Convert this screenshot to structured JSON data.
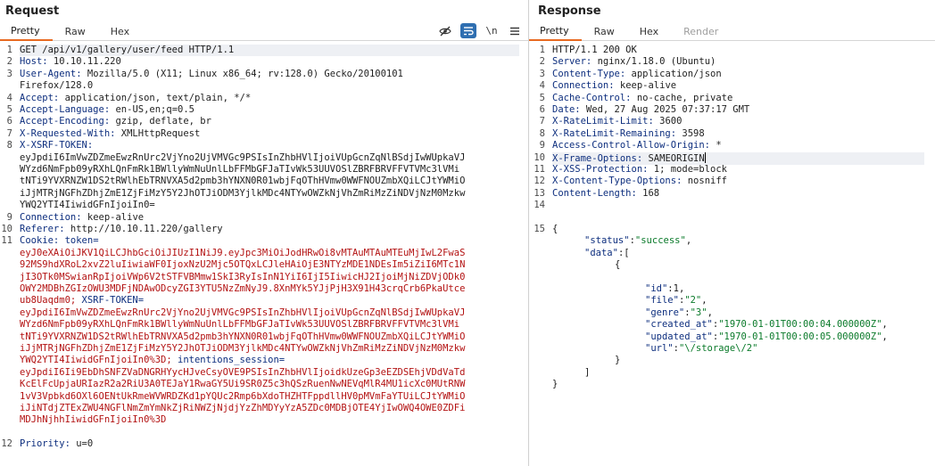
{
  "request": {
    "title": "Request",
    "tabs": [
      "Pretty",
      "Raw",
      "Hex"
    ],
    "toolbar": {
      "hide_icon": "eye-off",
      "wrap_icon": "wrap",
      "newline_label": "\\n",
      "menu_icon": "menu"
    },
    "line_numbers": [
      "1",
      "2",
      "3",
      "",
      "4",
      "5",
      "6",
      "7",
      "8",
      "",
      "",
      "",
      "",
      "",
      "",
      "9",
      "10",
      "11",
      "",
      "",
      "",
      "",
      "",
      "",
      "",
      "",
      "",
      "",
      "",
      "",
      "",
      "",
      "",
      "",
      "",
      "",
      "12"
    ],
    "request_line": "GET /api/v1/gallery/user/feed HTTP/1.1",
    "host_key": "Host:",
    "host_val": " 10.10.11.220",
    "ua_key": "User-Agent:",
    "ua_val": " Mozilla/5.0 (X11; Linux x86_64; rv:128.0) Gecko/20100101",
    "ua_cont": "Firefox/128.0",
    "accept_key": "Accept:",
    "accept_val": " application/json, text/plain, */*",
    "lang_key": "Accept-Language:",
    "lang_val": " en-US,en;q=0.5",
    "enc_key": "Accept-Encoding:",
    "enc_val": " gzip, deflate, br",
    "xrw_key": "X-Requested-With:",
    "xrw_val": " XMLHttpRequest",
    "xsrf_key": "X-XSRF-TOKEN:",
    "xsrf_lines": [
      "eyJpdiI6ImVwZDZmeEwzRnUrc2VjYno2UjVMVGc9PSIsInZhbHVlIjoiVUpGcnZqNlBSdjIwWUpkaVJ",
      "WYzd6NmFpb09yRXhLQnFmRk1BWllyWmNuUnlLbFFMbGFJaTIvWk53UUVOSlZBRFBRVFFVTVMc3lVMi",
      "tNTi9YVXRNZW1DS2tRWlhEbTRNVXA5d2pmb3hYNXN0R01wbjFqOThHVmw0WWFNOUZmbXQiLCJtYWMiO",
      "iJjMTRjNGFhZDhjZmE1ZjFiMzY5Y2JhOTJiODM3YjlkMDc4NTYwOWZkNjVhZmRiMzZiNDVjNzM0Mzkw",
      "YWQ2YTI4IiwidGFnIjoiIn0="
    ],
    "conn_key": "Connection:",
    "conn_val": " keep-alive",
    "ref_key": "Referer:",
    "ref_val": " http://10.10.11.220/gallery",
    "cookie_key": "Cookie:",
    "cookie_name": " token=",
    "cookie_lines": [
      "eyJ0eXAiOiJKV1QiLCJhbGciOiJIUzI1NiJ9.eyJpc3MiOiJodHRwOi8vMTAuMTAuMTEuMjIwL2FwaS",
      "92MS9hdXRoL2xvZ2luIiwiaWF0IjoxNzU2Mjc5OTQxLCJleHAiOjE3NTYzMDE1NDEsIm5iZiI6MTc1N",
      "jI3OTk0MSwianRpIjoiVWp6V2tSTFVBMmw1SkI3RyIsInN1YiI6IjI5IiwicHJ2IjoiMjNiZDVjODk0",
      "OWY2MDBhZGIzOWU3MDFjNDAwODcyZGI3YTU5NzZmNyJ9.8XnMYk5YJjPjH3X91H43crqCrb6PkaUtce",
      "ub8Uaqdm0;"
    ],
    "xsrf2_key": " XSRF-TOKEN=",
    "xsrf2_lines": [
      "eyJpdiI6ImVwZDZmeEwzRnUrc2VjYno2UjVMVGc9PSIsInZhbHVlIjoiVUpGcnZqNlBSdjIwWUpkaVJ",
      "WYzd6NmFpb09yRXhLQnFmRk1BWllyWmNuUnlLbFFMbGFJaTIvWk53UUVOSlZBRFBRVFFVTVMc3lVMi",
      "tNTi9YVXRNZW1DS2tRWlhEbTRNVXA5d2pmb3hYNXN0R01wbjFqOThHVmw0WWFNOUZmbXQiLCJtYWMiO",
      "iJjMTRjNGFhZDhjZmE1ZjFiMzY5Y2JhOTJiODM3YjlkMDc4NTYwOWZkNjVhZmRiMzZiNDVjNzM0Mzkw",
      "YWQ2YTI4IiwidGFnIjoiIn0%3D;"
    ],
    "session_key": " intentions_session=",
    "session_lines": [
      "eyJpdiI6Ii9EbDhSNFZVaDNGRHYycHJveCsyOVE9PSIsInZhbHVlIjoidkUzeGp3eEZDSEhjVDdVaTd",
      "KcElFcUpjaURIazR2a2RiU3A0TEJaY1RwaGY5Ui9SR0Z5c3hQSzRuenNwNEVqMlR4MU1icXc0MUtRNW",
      "1vV3Vpbkd6OXl6OENtUkRmeWVWRDZKd1pYQUc2Rmp6bXdoTHZHTFppdllHV0pMVmFaYTUiLCJtYWMiO",
      "iJiNTdjZTExZWU4NGFlNmZmYmNkZjRiNWZjNjdjYzZhMDYyYzA5ZDc0MDBjOTE4YjIwOWQ4OWE0ZDFi",
      "MDJhNjhhIiwidGFnIjoiIn0%3D"
    ],
    "prio_key": "Priority:",
    "prio_val": " u=0"
  },
  "response": {
    "title": "Response",
    "tabs": [
      "Pretty",
      "Raw",
      "Hex",
      "Render"
    ],
    "status_line": "HTTP/1.1 200 OK",
    "headers": [
      [
        "Server:",
        " nginx/1.18.0 (Ubuntu)"
      ],
      [
        "Content-Type:",
        " application/json"
      ],
      [
        "Connection:",
        " keep-alive"
      ],
      [
        "Cache-Control:",
        " no-cache, private"
      ],
      [
        "Date:",
        " Wed, 27 Aug 2025 07:37:17 GMT"
      ],
      [
        "X-RateLimit-Limit:",
        " 3600"
      ],
      [
        "X-RateLimit-Remaining:",
        " 3598"
      ],
      [
        "Access-Control-Allow-Origin:",
        " *"
      ],
      [
        "X-Frame-Options:",
        " SAMEORIGIN"
      ],
      [
        "X-XSS-Protection:",
        " 1; mode=block"
      ],
      [
        "X-Content-Type-Options:",
        " nosniff"
      ],
      [
        "Content-Length:",
        " 168"
      ]
    ],
    "line_numbers": [
      "1",
      "2",
      "3",
      "4",
      "5",
      "6",
      "7",
      "8",
      "9",
      "10",
      "11",
      "12",
      "13",
      "14",
      "15"
    ],
    "json": {
      "open": "{",
      "status_key": "\"status\"",
      "status_val": "\"success\"",
      "data_key": "\"data\"",
      "arr_open": "[",
      "obj_open": "{",
      "id_key": "\"id\"",
      "id_val": "1",
      "file_key": "\"file\"",
      "file_val": "\"2\"",
      "genre_key": "\"genre\"",
      "genre_val": "\"3\"",
      "created_key": "\"created_at\"",
      "created_val": "\"1970-01-01T00:00:04.000000Z\"",
      "updated_key": "\"updated_at\"",
      "updated_val": "\"1970-01-01T00:00:05.000000Z\"",
      "url_key": "\"url\"",
      "url_val": "\"\\/storage\\/2\"",
      "obj_close": "}",
      "arr_close": "]",
      "close": "}"
    }
  }
}
